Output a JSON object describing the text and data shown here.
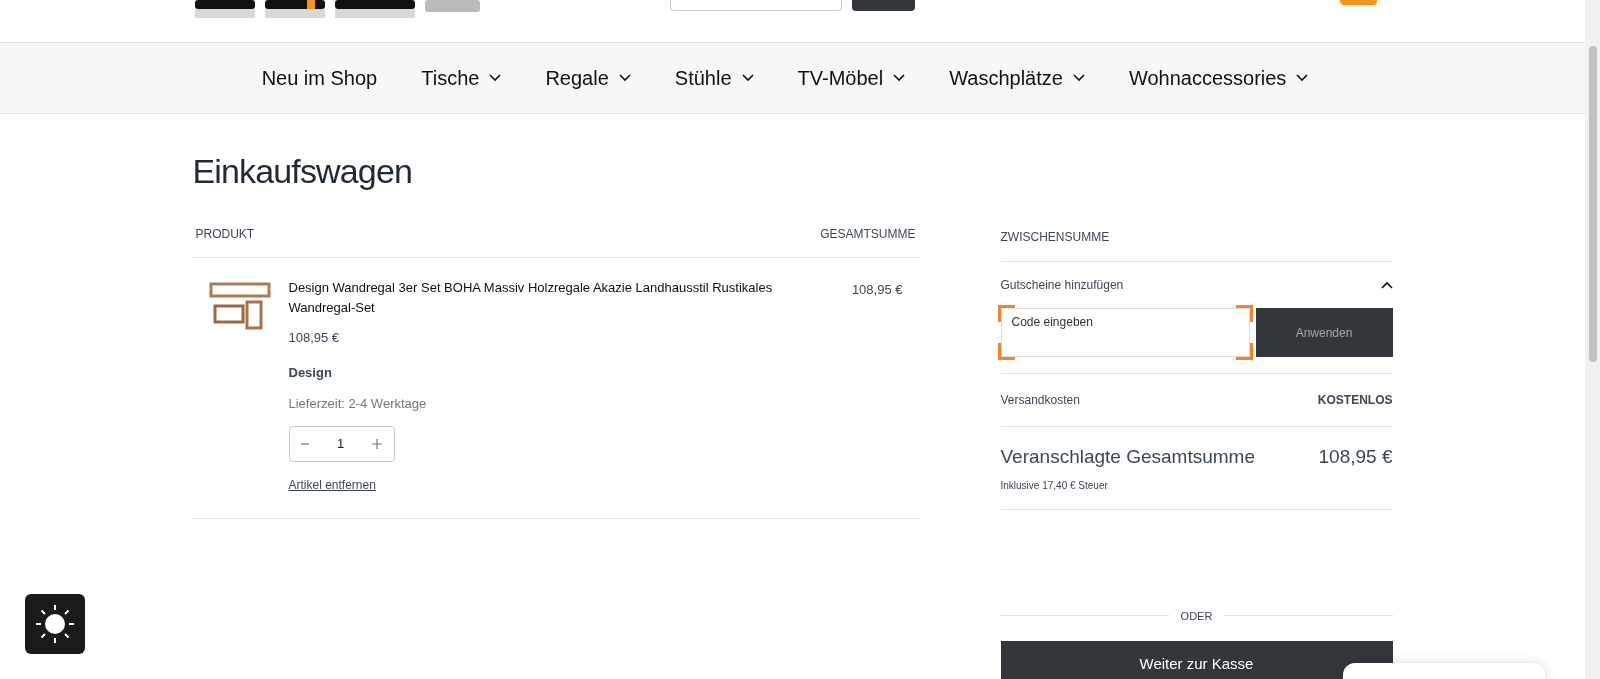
{
  "nav": [
    {
      "label": "Neu im Shop",
      "dropdown": false
    },
    {
      "label": "Tische",
      "dropdown": true
    },
    {
      "label": "Regale",
      "dropdown": true
    },
    {
      "label": "Stühle",
      "dropdown": true
    },
    {
      "label": "TV-Möbel",
      "dropdown": true
    },
    {
      "label": "Waschplätze",
      "dropdown": true
    },
    {
      "label": "Wohnaccessories",
      "dropdown": true
    }
  ],
  "page_title": "Einkaufswagen",
  "cart": {
    "columns": [
      "PRODUKT",
      "GESAMTSUMME"
    ],
    "items": [
      {
        "name": "Design Wandregal 3er Set BOHA Massiv Holzregale Akazie Landhausstil Rustikales Wandregal-Set",
        "price": "108,95 €",
        "variant": "Design",
        "delivery": "Lieferzeit: 2-4 Werktage",
        "quantity": "1",
        "total": "108,95 €",
        "remove": "Artikel entfernen"
      }
    ]
  },
  "summary": {
    "heading": "ZWISCHENSUMME",
    "coupon": {
      "label": "Gutscheine hinzufügen",
      "expanded": true,
      "placeholder": "Code eingeben",
      "button": "Anwenden"
    },
    "shipping": {
      "label": "Versandkosten",
      "value": "KOSTENLOS"
    },
    "total": {
      "label": "Veranschlagte Gesamtsumme",
      "value": "108,95 €",
      "tax_note": "Inklusive 17,40 € Steuer"
    },
    "divider_label": "ODER",
    "checkout_button": "Weiter zur Kasse"
  }
}
